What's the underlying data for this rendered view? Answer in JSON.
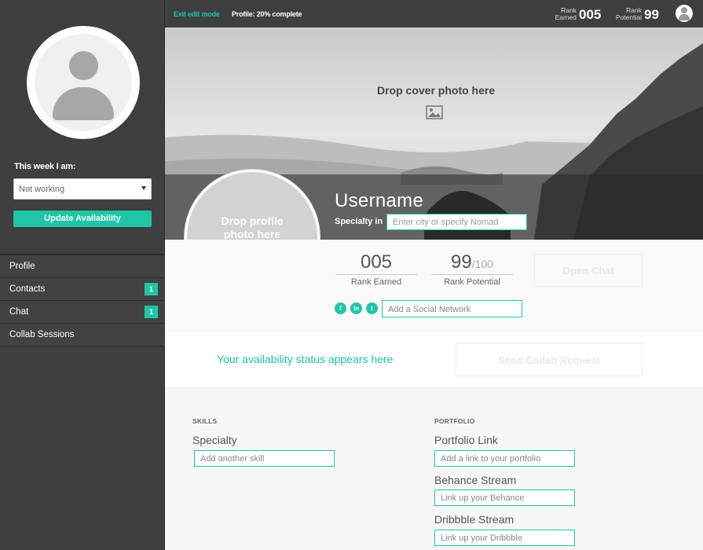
{
  "topbar": {
    "exit_edit": "Exit edit mode",
    "profile_complete": "Profile: 20% complete",
    "rank_earned_label_1": "Rank",
    "rank_earned_label_2": "Earned",
    "rank_earned_value": "005",
    "rank_potential_label_1": "Rank",
    "rank_potential_label_2": "Potential",
    "rank_potential_value": "99"
  },
  "sidebar": {
    "week_label": "This week I am:",
    "availability_selected": "Not working",
    "update_button": "Update Availability",
    "items": [
      {
        "label": "Profile",
        "badge": ""
      },
      {
        "label": "Contacts",
        "badge": "1"
      },
      {
        "label": "Chat",
        "badge": "1"
      },
      {
        "label": "Collab Sessions",
        "badge": ""
      }
    ]
  },
  "cover": {
    "drop_text": "Drop cover photo here",
    "username": "Username",
    "specialty_label": "Specialty in",
    "specialty_placeholder": "Enter city or specify Nomad"
  },
  "profile_photo": {
    "drop_line1": "Drop profile",
    "drop_line2": "photo here"
  },
  "stats": {
    "rank_earned": "005",
    "rank_earned_caption": "Rank Earned",
    "rank_potential": "99",
    "rank_potential_max": "/100",
    "rank_potential_caption": "Rank Potential",
    "open_chat": "Open Chat",
    "social_placeholder": "Add a Social Network",
    "social_icons": [
      "facebook-icon",
      "linkedin-icon",
      "twitter-icon"
    ]
  },
  "availability": {
    "status_text": "Your availability status appears here",
    "collab_button": "Send Collab Request"
  },
  "skills": {
    "heading": "SKILLS",
    "specialty_label": "Specialty",
    "skill_placeholder": "Add another skill"
  },
  "portfolio": {
    "heading": "PORTFOLIO",
    "link_label": "Portfolio Link",
    "link_placeholder": "Add a link to your portfolio",
    "behance_label": "Behance Stream",
    "behance_placeholder": "Link up your Behance",
    "dribbble_label": "Dribbble Stream",
    "dribbble_placeholder": "Link up your Dribbble"
  },
  "colors": {
    "accent": "#1ec6a6",
    "sidebar_bg": "#3f3f3f"
  }
}
